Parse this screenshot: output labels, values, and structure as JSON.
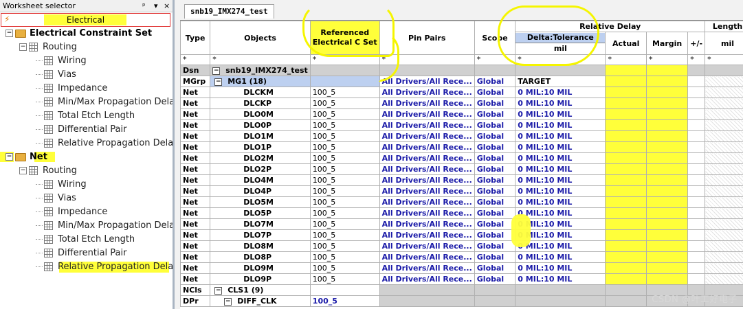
{
  "left_panel": {
    "title": "Worksheet selector",
    "controls": [
      "ᵖ",
      "▾",
      "×"
    ],
    "selected": "Electrical",
    "tree": [
      {
        "label": "Electrical Constraint Set",
        "level": 0,
        "type": "folder",
        "bold": true,
        "expander": "−"
      },
      {
        "label": "Routing",
        "level": 1,
        "type": "group",
        "expander": "−"
      },
      {
        "label": "Wiring",
        "level": 2,
        "type": "sheet"
      },
      {
        "label": "Vias",
        "level": 2,
        "type": "sheet"
      },
      {
        "label": "Impedance",
        "level": 2,
        "type": "sheet"
      },
      {
        "label": "Min/Max Propagation Delays",
        "level": 2,
        "type": "sheet"
      },
      {
        "label": "Total Etch Length",
        "level": 2,
        "type": "sheet"
      },
      {
        "label": "Differential Pair",
        "level": 2,
        "type": "sheet"
      },
      {
        "label": "Relative Propagation Delay",
        "level": 2,
        "type": "sheet"
      },
      {
        "label": "Net",
        "level": 0,
        "type": "folder",
        "bold": true,
        "expander": "−"
      },
      {
        "label": "Routing",
        "level": 1,
        "type": "group",
        "expander": "−"
      },
      {
        "label": "Wiring",
        "level": 2,
        "type": "sheet"
      },
      {
        "label": "Vias",
        "level": 2,
        "type": "sheet"
      },
      {
        "label": "Impedance",
        "level": 2,
        "type": "sheet"
      },
      {
        "label": "Min/Max Propagation Delays",
        "level": 2,
        "type": "sheet"
      },
      {
        "label": "Total Etch Length",
        "level": 2,
        "type": "sheet"
      },
      {
        "label": "Differential Pair",
        "level": 2,
        "type": "sheet"
      },
      {
        "label": "Relative Propagation Delay",
        "level": 2,
        "type": "sheet"
      }
    ]
  },
  "tab": {
    "label": "snb19_IMX274_test"
  },
  "table": {
    "headers": {
      "type": "Type",
      "objects": "Objects",
      "ref_line1": "Referenced",
      "ref_line2": "Electrical C Set",
      "pin_pairs": "Pin Pairs",
      "scope": "Scope",
      "relative_delay": "Relative Delay",
      "delta_tol": "Delta:Tolerance",
      "delta_unit": "mil",
      "actual": "Actual",
      "margin": "Margin",
      "plusminus": "+/-",
      "length": "Length",
      "length_unit": "mil"
    },
    "filter_row": [
      "*",
      "*",
      "*",
      "*",
      "*",
      "*",
      "*",
      "*",
      "*",
      "*"
    ],
    "dsn": {
      "type": "Dsn",
      "object": "snb19_IMX274_test"
    },
    "mgrp": {
      "type": "MGrp",
      "object": "MG1 (18)",
      "pin_pairs": "All Drivers/All Rece...",
      "scope": "Global",
      "delta": "TARGET"
    },
    "nets": [
      {
        "type": "Net",
        "object": "DLCKM",
        "ref": "100_5",
        "pin_pairs": "All Drivers/All Rece...",
        "scope": "Global",
        "delta": "0 MIL:10 MIL"
      },
      {
        "type": "Net",
        "object": "DLCKP",
        "ref": "100_5",
        "pin_pairs": "All Drivers/All Rece...",
        "scope": "Global",
        "delta": "0 MIL:10 MIL"
      },
      {
        "type": "Net",
        "object": "DLO0M",
        "ref": "100_5",
        "pin_pairs": "All Drivers/All Rece...",
        "scope": "Global",
        "delta": "0 MIL:10 MIL"
      },
      {
        "type": "Net",
        "object": "DLO0P",
        "ref": "100_5",
        "pin_pairs": "All Drivers/All Rece...",
        "scope": "Global",
        "delta": "0 MIL:10 MIL"
      },
      {
        "type": "Net",
        "object": "DLO1M",
        "ref": "100_5",
        "pin_pairs": "All Drivers/All Rece...",
        "scope": "Global",
        "delta": "0 MIL:10 MIL"
      },
      {
        "type": "Net",
        "object": "DLO1P",
        "ref": "100_5",
        "pin_pairs": "All Drivers/All Rece...",
        "scope": "Global",
        "delta": "0 MIL:10 MIL"
      },
      {
        "type": "Net",
        "object": "DLO2M",
        "ref": "100_5",
        "pin_pairs": "All Drivers/All Rece...",
        "scope": "Global",
        "delta": "0 MIL:10 MIL"
      },
      {
        "type": "Net",
        "object": "DLO2P",
        "ref": "100_5",
        "pin_pairs": "All Drivers/All Rece...",
        "scope": "Global",
        "delta": "0 MIL:10 MIL"
      },
      {
        "type": "Net",
        "object": "DLO4M",
        "ref": "100_5",
        "pin_pairs": "All Drivers/All Rece...",
        "scope": "Global",
        "delta": "0 MIL:10 MIL"
      },
      {
        "type": "Net",
        "object": "DLO4P",
        "ref": "100_5",
        "pin_pairs": "All Drivers/All Rece...",
        "scope": "Global",
        "delta": "0 MIL:10 MIL"
      },
      {
        "type": "Net",
        "object": "DLO5M",
        "ref": "100_5",
        "pin_pairs": "All Drivers/All Rece...",
        "scope": "Global",
        "delta": "0 MIL:10 MIL"
      },
      {
        "type": "Net",
        "object": "DLO5P",
        "ref": "100_5",
        "pin_pairs": "All Drivers/All Rece...",
        "scope": "Global",
        "delta": "0 MIL:10 MIL"
      },
      {
        "type": "Net",
        "object": "DLO7M",
        "ref": "100_5",
        "pin_pairs": "All Drivers/All Rece...",
        "scope": "Global",
        "delta": "0 MIL:10 MIL"
      },
      {
        "type": "Net",
        "object": "DLO7P",
        "ref": "100_5",
        "pin_pairs": "All Drivers/All Rece...",
        "scope": "Global",
        "delta": "0 MIL:10 MIL"
      },
      {
        "type": "Net",
        "object": "DLO8M",
        "ref": "100_5",
        "pin_pairs": "All Drivers/All Rece...",
        "scope": "Global",
        "delta": "0 MIL:10 MIL"
      },
      {
        "type": "Net",
        "object": "DLO8P",
        "ref": "100_5",
        "pin_pairs": "All Drivers/All Rece...",
        "scope": "Global",
        "delta": "0 MIL:10 MIL"
      },
      {
        "type": "Net",
        "object": "DLO9M",
        "ref": "100_5",
        "pin_pairs": "All Drivers/All Rece...",
        "scope": "Global",
        "delta": "0 MIL:10 MIL"
      },
      {
        "type": "Net",
        "object": "DLO9P",
        "ref": "100_5",
        "pin_pairs": "All Drivers/All Rece...",
        "scope": "Global",
        "delta": "0 MIL:10 MIL"
      }
    ],
    "ncls": {
      "type": "NCls",
      "object": "CLS1 (9)"
    },
    "dpr": {
      "type": "DPr",
      "object": "DIFF_CLK",
      "ref": "100_5"
    }
  },
  "watermark": "CSDN @叶工好电子",
  "colors": {
    "highlight": "#ffff3a",
    "link_blue": "#1a1aa8",
    "group_row": "#d0d0d0",
    "mgrp_cell": "#bdd0f0"
  }
}
